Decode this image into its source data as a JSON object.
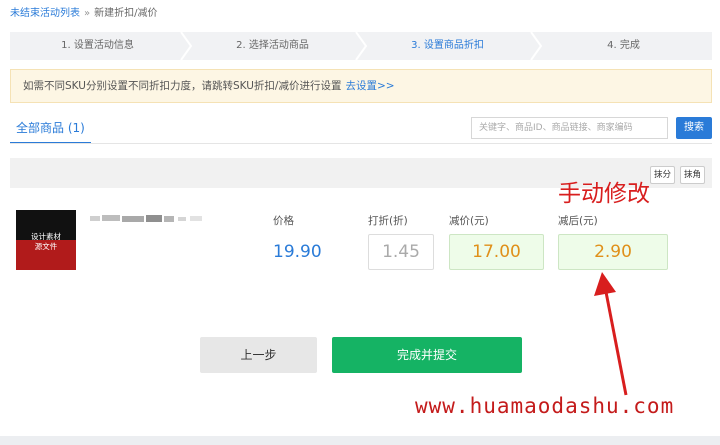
{
  "breadcrumb": {
    "parent": "未结束活动列表",
    "separator": "»",
    "current": "新建折扣/减价"
  },
  "steps": [
    {
      "label": "1. 设置活动信息"
    },
    {
      "label": "2. 选择活动商品"
    },
    {
      "label": "3. 设置商品折扣",
      "active": true
    },
    {
      "label": "4. 完成"
    }
  ],
  "notice": {
    "text": "如需不同SKU分别设置不同折扣力度，请跳转SKU折扣/减价进行设置",
    "link": "去设置>>"
  },
  "tabs": {
    "all_products": "全部商品 (1)"
  },
  "search": {
    "placeholder": "关键字、商品ID、商品链接、商家编码",
    "button": "搜索"
  },
  "toolbar": {
    "round_cents": "抹分",
    "round_jiao": "抹角"
  },
  "product": {
    "thumb_text_line1": "设计素材",
    "thumb_text_line2": "源文件",
    "price_label": "价格",
    "price": "19.90",
    "discount_label": "打折(折)",
    "discount_value": "1.45",
    "reduce_label": "减价(元)",
    "reduce_value": "17.00",
    "after_label": "减后(元)",
    "after_value": "2.90"
  },
  "annotation": {
    "hint": "手动修改",
    "watermark": "www.huamaodashu.com"
  },
  "actions": {
    "prev": "上一步",
    "submit": "完成并提交"
  },
  "colors": {
    "accent": "#2a7bd8",
    "submit": "#15b364",
    "annotation": "#d81e1e"
  }
}
